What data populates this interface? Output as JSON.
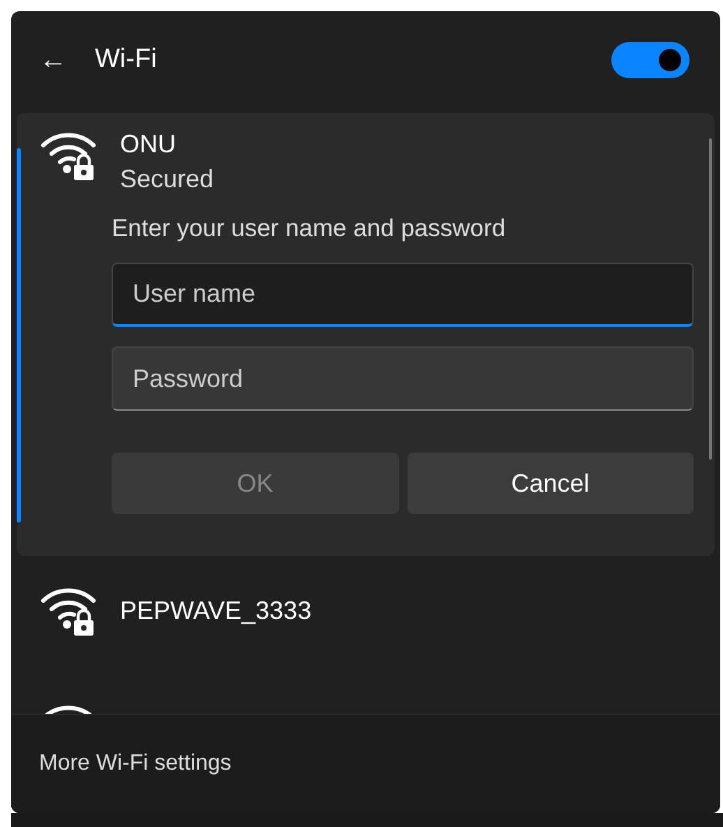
{
  "header": {
    "back": "←",
    "title": "Wi-Fi",
    "wifi_on": true
  },
  "networks": [
    {
      "name": "ONU",
      "status": "Secured",
      "expanded": true,
      "secured": true,
      "form": {
        "prompt": "Enter your user name and password",
        "fields": [
          {
            "placeholder": "User name",
            "focused": true
          },
          {
            "placeholder": "Password",
            "focused": false
          }
        ],
        "buttons": [
          {
            "label": "OK",
            "disabled": true
          },
          {
            "label": "Cancel",
            "disabled": false
          }
        ]
      }
    },
    {
      "name": "PEPWAVE_3333",
      "expanded": false,
      "secured": true
    },
    {
      "expanded": false
    }
  ],
  "footer": {
    "link": "More Wi-Fi settings"
  }
}
